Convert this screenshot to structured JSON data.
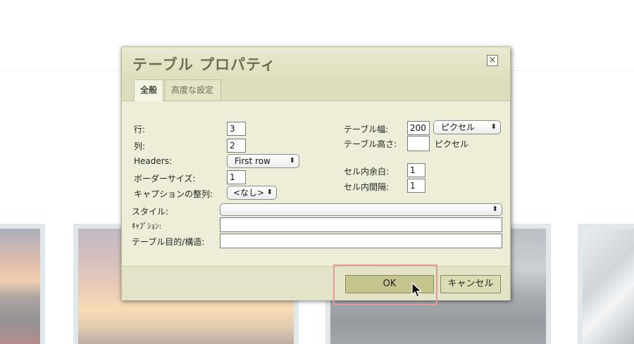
{
  "dialog": {
    "title": "テーブル プロパティ",
    "tabs": [
      {
        "label": "全般",
        "active": true
      },
      {
        "label": "高度な設定",
        "active": false
      }
    ],
    "fields": {
      "rows": {
        "label": "行:",
        "value": "3"
      },
      "cols": {
        "label": "列:",
        "value": "2"
      },
      "headers": {
        "label": "Headers:",
        "value": "First row"
      },
      "border": {
        "label": "ボーダーサイズ:",
        "value": "1"
      },
      "align": {
        "label": "キャプションの整列:",
        "value": "<なし>"
      },
      "width": {
        "label": "テーブル幅:",
        "value": "200",
        "unit": "ピクセル"
      },
      "height": {
        "label": "テーブル高さ:",
        "value": "",
        "unit": "ピクセル"
      },
      "cellpadding": {
        "label": "セル内余白:",
        "value": "1"
      },
      "cellspacing": {
        "label": "セル内間隔:",
        "value": "1"
      },
      "style": {
        "label": "スタイル:",
        "value": ""
      },
      "caption": {
        "label": "ｷｬﾌﾟｼｮﾝ:",
        "value": ""
      },
      "summary": {
        "label": "テーブル目的/構造:",
        "value": ""
      }
    },
    "buttons": {
      "ok": "OK",
      "cancel": "キャンセル"
    }
  },
  "icons": {
    "close": "close-icon",
    "dropdown": "chevron-updown-icon",
    "cursor": "mouse-pointer-icon"
  },
  "colors": {
    "dialog_bg": "#eeeed8",
    "ok_button": "#c4c48c",
    "highlight": "#e29a9a"
  }
}
